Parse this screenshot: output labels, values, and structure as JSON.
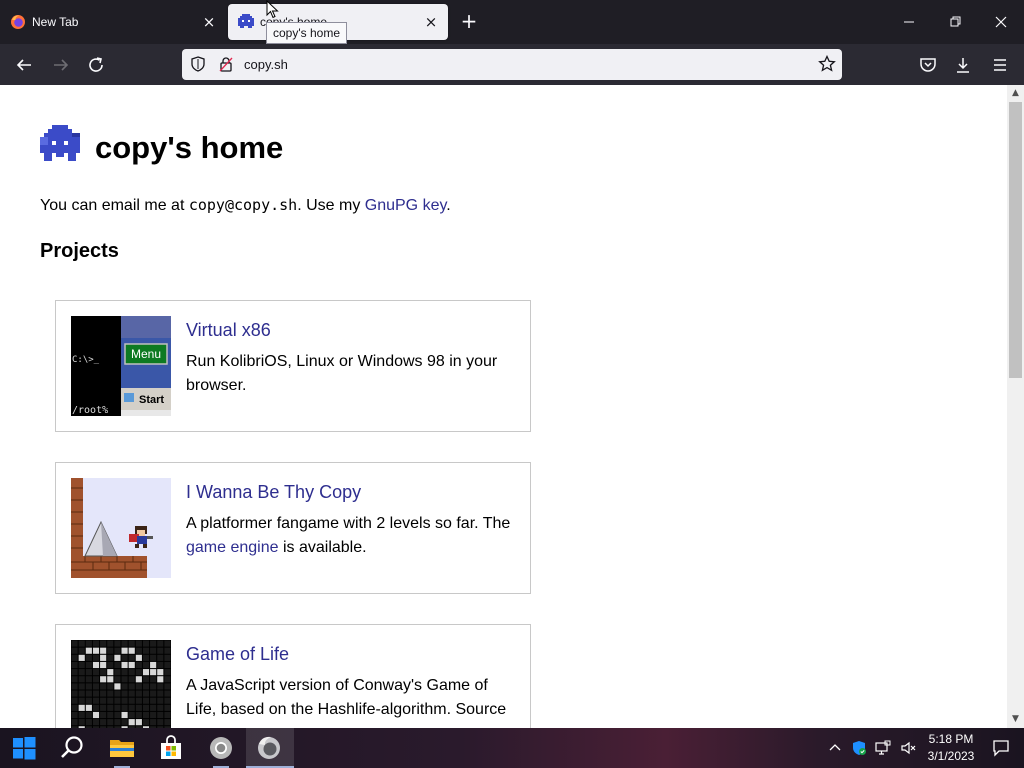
{
  "browser": {
    "tabs": [
      {
        "title": "New Tab",
        "active": false
      },
      {
        "title": "copy's home",
        "active": true
      }
    ],
    "tooltip": "copy's home",
    "url": "copy.sh"
  },
  "page": {
    "title": "copy's home",
    "intro": {
      "prefix": "You can email me at ",
      "email": "copy@copy.sh",
      "middle": ". Use my ",
      "gnupg_link": "GnuPG key",
      "suffix": "."
    },
    "projects_heading": "Projects",
    "projects": [
      {
        "title": "Virtual x86",
        "description": "Run KolibriOS, Linux or Windows 98 in your browser.",
        "thumb_labels": {
          "prompt": "C:\\>_",
          "menu": "Menu",
          "start": "Start",
          "path": "/root%"
        }
      },
      {
        "title": "I Wanna Be Thy Copy",
        "description_prefix": "A platformer fangame with 2 levels so far. The ",
        "description_link": "game engine",
        "description_suffix": " is available."
      },
      {
        "title": "Game of Life",
        "description": "A JavaScript version of Conway's Game of Life, based on the Hashlife-algorithm. Source"
      }
    ]
  },
  "taskbar": {
    "time": "5:18 PM",
    "date": "3/1/2023"
  },
  "colors": {
    "tabstrip": "#1f1e25",
    "navbar": "#2b2a33",
    "link": "#2e2e8f",
    "logo": "#3b4bc8"
  }
}
